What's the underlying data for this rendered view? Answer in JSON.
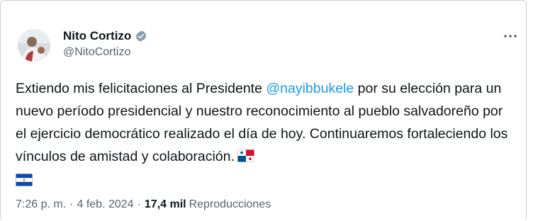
{
  "author": {
    "display_name": "Nito Cortizo",
    "handle": "@NitoCortizo",
    "verified": true,
    "avatar_icon": "profile-photo"
  },
  "more_icon": "ellipsis-icon",
  "tweet": {
    "text_before": "Extiendo mis felicitaciones al Presidente ",
    "mention": "@nayibbukele",
    "text_after": " por su elección para un nuevo período presidencial y nuestro reconocimiento al pueblo salvadoreño por el ejercicio democrático realizado el día de hoy. Continuaremos fortaleciendo los vínculos de amistad y colaboración.",
    "emojis": [
      "flag-panama",
      "flag-el-salvador"
    ]
  },
  "meta": {
    "time": "7:26 p. m.",
    "date": "4 feb. 2024",
    "separator": "·",
    "views_count": "17,4 mil",
    "views_label": "Reproducciones"
  },
  "colors": {
    "text": "#0f1419",
    "secondary": "#536471",
    "mention": "#1d9bf0",
    "verified_badge": "#829aab"
  }
}
